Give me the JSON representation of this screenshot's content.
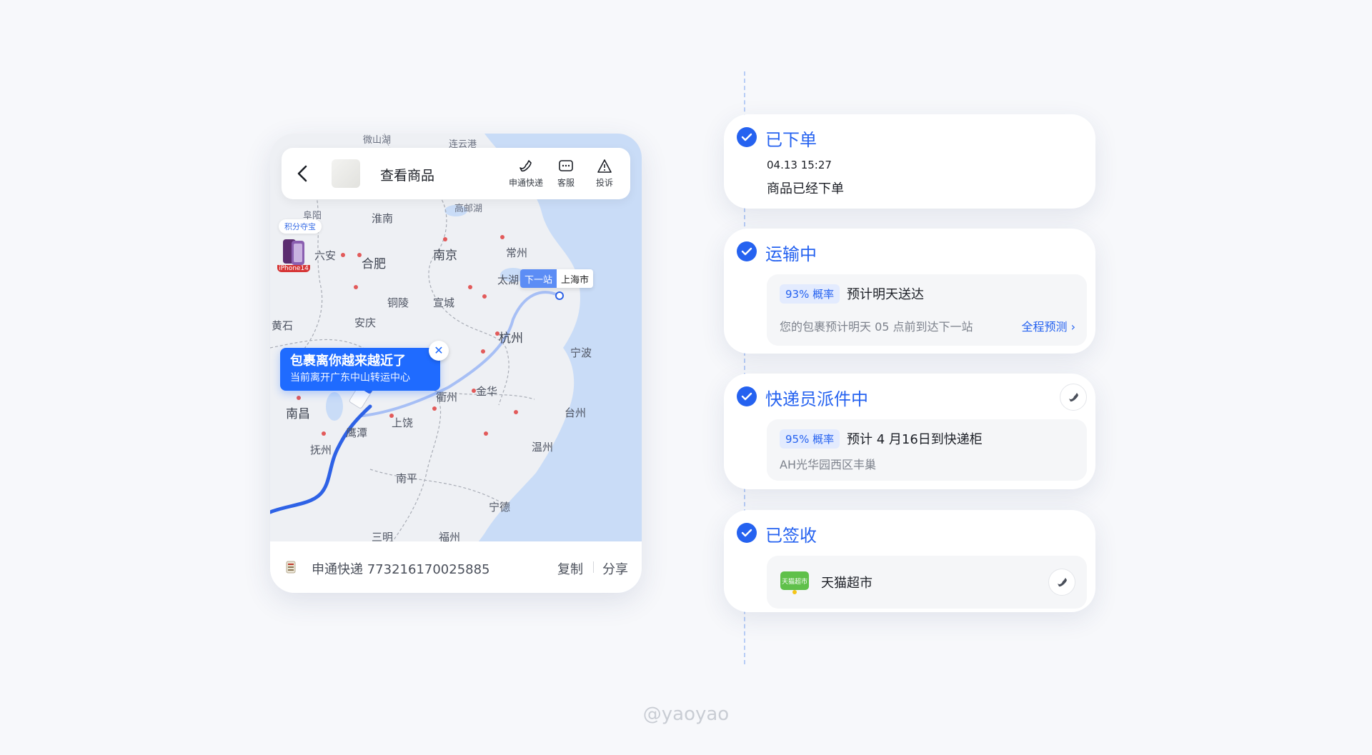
{
  "map": {
    "topbar": {
      "title": "查看商品",
      "actions": [
        {
          "icon": "phone-icon",
          "label": "申通快递"
        },
        {
          "icon": "chat-icon",
          "label": "客服"
        },
        {
          "icon": "warning-icon",
          "label": "投诉"
        }
      ]
    },
    "points_badge": "积分夺宝",
    "promo_label": "iPhone14",
    "cities": [
      "微山湖",
      "连云港",
      "阜阳",
      "淮南",
      "高邮湖",
      "六安",
      "合肥",
      "南京",
      "常州",
      "太湖",
      "上海市",
      "铜陵",
      "宣城",
      "安庆",
      "黄石",
      "杭州",
      "宁波",
      "衢州",
      "金华",
      "南昌",
      "鹰潭",
      "上饶",
      "台州",
      "抚州",
      "温州",
      "南平",
      "宁德",
      "三明",
      "福州"
    ],
    "next_stop_tag": {
      "label": "下一站",
      "city": "上海市"
    },
    "bubble": {
      "title": "包裹离你越来越近了",
      "subtitle": "当前离开广东中山转运中心"
    },
    "tracking": {
      "text": "申通快递 773216170025885",
      "copy": "复制",
      "share": "分享"
    }
  },
  "timeline": [
    {
      "title": "已下单",
      "time": "04.13 15:27",
      "desc": "商品已经下单"
    },
    {
      "title": "运输中",
      "probability": "93% 概率",
      "eta": "预计明天送达",
      "note": "您的包裹预计明天 05 点前到达下一站",
      "link": "全程预测"
    },
    {
      "title": "快递员派件中",
      "probability": "95% 概率",
      "eta": "预计 4 月16日到快递柜",
      "note": "AH光华园西区丰巢"
    },
    {
      "title": "已签收",
      "store_logo": "天猫超市",
      "store_name": "天猫超市"
    }
  ],
  "colors": {
    "accent": "#2562f0",
    "bubble": "#1f6bff",
    "sea": "#c9dcf7",
    "land": "#eef0f4"
  },
  "watermark": "@yaoyao"
}
